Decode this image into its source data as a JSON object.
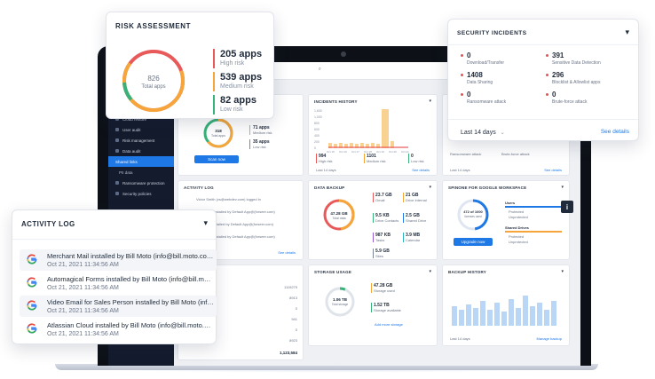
{
  "dashboard": {
    "sidebar": [
      {
        "label": "Cloud restore",
        "state": "normal"
      },
      {
        "label": "User audit",
        "state": "normal"
      },
      {
        "label": "Risk management",
        "state": "normal"
      },
      {
        "label": "Data audit",
        "state": "normal"
      },
      {
        "label": "Shared links",
        "state": "active"
      },
      {
        "label": "PII data",
        "state": "sub"
      },
      {
        "label": "Ransomware protection",
        "state": "normal"
      },
      {
        "label": "Security policies",
        "state": "normal"
      }
    ],
    "risk_card": {
      "title": "",
      "total": "318",
      "total_label": "Total apps",
      "stats": [
        {
          "value": "71 apps",
          "label": "Medium risk"
        },
        {
          "value": "35 apps",
          "label": "Low risk"
        }
      ],
      "button": "Scan now"
    },
    "incidents_card": {
      "title": "INCIDENTS HISTORY",
      "y_ticks": [
        "1,600",
        "1,000",
        "800",
        "600",
        "400",
        "200",
        "0"
      ],
      "x_ticks": [
        "Oct 15",
        "Oct 16",
        "Oct 17",
        "Oct 18",
        "Oct 19",
        "Oct 20",
        "Oct 21"
      ],
      "stats": [
        {
          "value": "994",
          "label": "High risk"
        },
        {
          "value": "1101",
          "label": "Medium risk"
        },
        {
          "value": "0",
          "label": "Low risk"
        }
      ],
      "period": "Last 14 days",
      "link": "See details"
    },
    "mini_incidents_card": {
      "period": "Last 14 days",
      "link": "See details",
      "labels": [
        "Ransomware attack",
        "Brute-force attack"
      ]
    },
    "activity_card": {
      "title": "ACTIVITY LOG",
      "rows": [
        "Victor Smith (vs@webdev.com) logged in",
        "Essentials installed by Default App@(forseer.com)",
        "Inventory installed by Default App@(forseer.com)",
        "Essentials installed by Default App@(forseer.com)"
      ],
      "link": "See details"
    },
    "backup_card": {
      "title": "DATA BACKUP",
      "total": "47.28 GB",
      "total_label": "Total data",
      "items": [
        {
          "value": "23.7 GB",
          "label": "Gmail"
        },
        {
          "value": "21 GB",
          "label": "Drive Internal"
        },
        {
          "value": "9.5 KB",
          "label": "Drive Contacts"
        },
        {
          "value": "2.5 GB",
          "label": "Shared Drive"
        },
        {
          "value": "987 KB",
          "label": "Tasks"
        },
        {
          "value": "3.9 MB",
          "label": "Calendar"
        },
        {
          "value": "5.9 GB",
          "label": "Sites"
        }
      ]
    },
    "gws_card": {
      "title": "SPINONE FOR GOOGLE WORKSPACE",
      "gauge": "472 of 1000",
      "gauge_label": "licenses used",
      "button": "Upgrade now",
      "users": "Users",
      "shared": "Shared Drives",
      "legend": [
        "Protected",
        "Unprotected",
        "Protected",
        "Unprotected"
      ]
    },
    "table_card": {
      "values": [
        "1119279",
        "8913",
        "0",
        "941",
        "0",
        "8923",
        "1,123,584"
      ]
    },
    "storage_card": {
      "title": "STORAGE USAGE",
      "gauge": "1.06 TB",
      "gauge_label": "Total storage",
      "items": [
        {
          "value": "47.28 GB",
          "label": "Storage used"
        },
        {
          "value": "1.52 TB",
          "label": "Storage available"
        }
      ],
      "link": "Add more storage"
    },
    "backup_history": {
      "title": "BACKUP HISTORY",
      "period": "Last 14 days",
      "link": "Manage backup"
    }
  },
  "risk_assessment": {
    "title": "RISK ASSESSMENT",
    "total": "826",
    "total_label": "Total apps",
    "stats": [
      {
        "value": "205 apps",
        "label": "High risk",
        "color": "#e85a5a"
      },
      {
        "value": "539 apps",
        "label": "Medium risk",
        "color": "#f5a53a"
      },
      {
        "value": "82 apps",
        "label": "Low risk",
        "color": "#37b27a"
      }
    ]
  },
  "security_incidents": {
    "title": "SECURITY INCIDENTS",
    "items": [
      {
        "value": "0",
        "label": "Download/Transfer"
      },
      {
        "value": "391",
        "label": "Sensitive Data Detection"
      },
      {
        "value": "1408",
        "label": "Data Sharing"
      },
      {
        "value": "296",
        "label": "Blocklist & Allowlist apps"
      },
      {
        "value": "0",
        "label": "Ransomware attack"
      },
      {
        "value": "0",
        "label": "Brute-force attack"
      }
    ],
    "period": "Last 14 days",
    "link": "See details"
  },
  "activity_log": {
    "title": "ACTIVITY LOG",
    "rows": [
      {
        "text": "Merchant Mail installed by Bill Moto (info@bill.moto.com)",
        "time": "Oct 21, 2021 11:34:56 AM"
      },
      {
        "text": "Automagical Forms installed by Bill Moto (info@bill.moto.com)",
        "time": "Oct 21, 2021 11:34:56 AM"
      },
      {
        "text": "Video Email for Sales Person installed by Bill Moto (info@bill.moto.com)",
        "time": "Oct 21, 2021 11:34:56 AM"
      },
      {
        "text": "Atlassian Cloud installed by Bill Moto (info@bill.moto.com)",
        "time": "Oct 21, 2021 11:34:56 AM"
      }
    ]
  },
  "colors": {
    "accent": "#1e78e6",
    "high": "#e85a5a",
    "medium": "#f5a53a",
    "low": "#37b27a"
  }
}
